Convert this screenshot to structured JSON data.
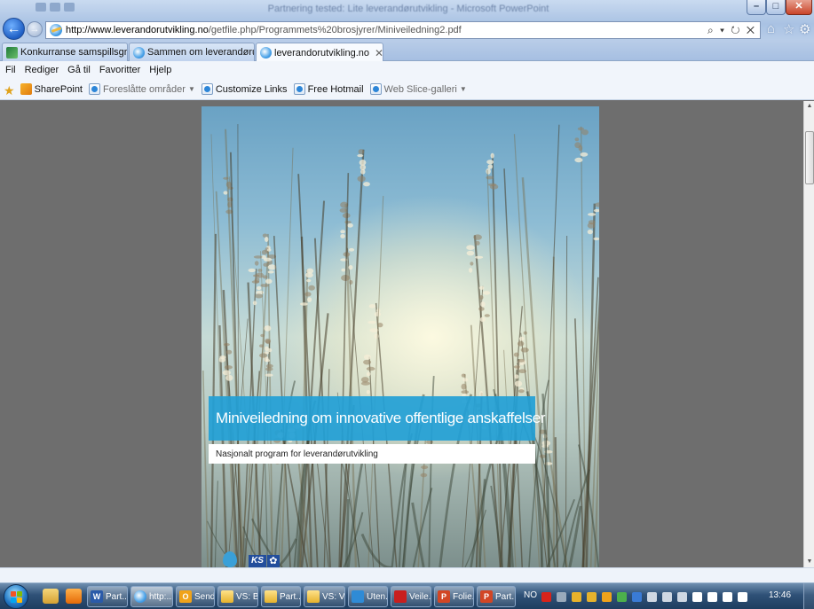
{
  "window": {
    "blurred_title": "Partnering tested: Lite leverandørutvikling - Microsoft PowerPoint",
    "controls": {
      "minimize": "–",
      "maximize": "□",
      "close": "✕"
    }
  },
  "address_bar": {
    "url_domain": "http://www.leverandorutvikling.no",
    "url_path": "/getfile.php/Programmets%20brosjyrer/Miniveiledning2.pdf",
    "tools": "⌕ ▾ ↻ ✕"
  },
  "tabs": [
    {
      "label": "Konkurranse samspillsgruppe -...",
      "icon": "site-icon"
    },
    {
      "label": "Sammen om leverandørutvikli...",
      "icon": "ie-page-icon"
    },
    {
      "label": "leverandorutvikling.no",
      "icon": "ie-page-icon",
      "active": true,
      "close": "✕"
    }
  ],
  "menu": [
    "Fil",
    "Rediger",
    "Gå til",
    "Favoritter",
    "Hjelp"
  ],
  "favorites": [
    {
      "label": "SharePoint",
      "icon": "sharepoint-icon"
    },
    {
      "label": "Foreslåtte områder",
      "icon": "ie-page-icon",
      "dropdown": true,
      "dim": true
    },
    {
      "label": "Customize Links",
      "icon": "ie-page-icon"
    },
    {
      "label": "Free Hotmail",
      "icon": "ie-page-icon"
    },
    {
      "label": "Web Slice-galleri",
      "icon": "ie-page-icon",
      "dropdown": true,
      "dim": true
    }
  ],
  "document": {
    "cover_title": "Miniveiledning om innovative offentlige anskaffelser",
    "cover_subtitle": "Nasjonalt program for leverandørutvikling",
    "logo_text": "KS",
    "colors": {
      "title_band": "#22a0d6",
      "ks_blue": "#234e9c"
    }
  },
  "taskbar": {
    "items": [
      {
        "label": "Part...",
        "icon": "word-icon",
        "glyph": "W"
      },
      {
        "label": "http:...",
        "icon": "ie-icon",
        "glyph": "",
        "active": true
      },
      {
        "label": "Send...",
        "icon": "outlook-icon",
        "glyph": "O"
      },
      {
        "label": "VS: B...",
        "icon": "mail-icon",
        "glyph": ""
      },
      {
        "label": "Part...",
        "icon": "mail-icon",
        "glyph": ""
      },
      {
        "label": "VS: V...",
        "icon": "mail-icon",
        "glyph": ""
      },
      {
        "label": "Uten...",
        "icon": "presentation-icon",
        "glyph": ""
      },
      {
        "label": "Veile...",
        "icon": "pdf-icon",
        "glyph": ""
      },
      {
        "label": "Folie...",
        "icon": "powerpoint-icon",
        "glyph": "P"
      },
      {
        "label": "Part...",
        "icon": "powerpoint-icon",
        "glyph": "P"
      }
    ],
    "language": "NO",
    "clock": "13:46"
  }
}
